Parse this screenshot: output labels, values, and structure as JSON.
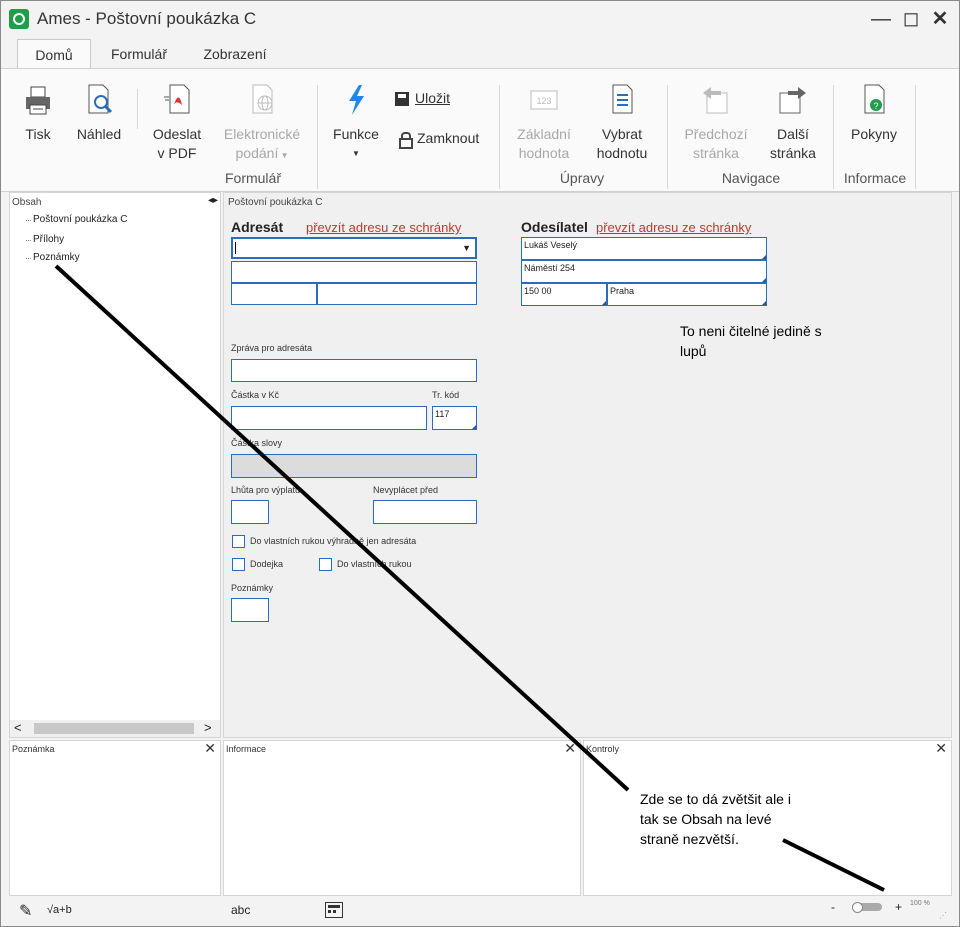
{
  "window": {
    "title": "Ames - Poštovní poukázka C"
  },
  "tabs": [
    {
      "label": "Domů"
    },
    {
      "label": "Formulář"
    },
    {
      "label": "Zobrazení"
    }
  ],
  "ribbon": {
    "print": "Tisk",
    "preview": "Náhled",
    "send_pdf_1": "Odeslat",
    "send_pdf_2": "v PDF",
    "efile_1": "Elektronické",
    "efile_2": "podání",
    "functions": "Funkce",
    "save": "Uložit",
    "lock": "Zamknout",
    "base_value_1": "Základní",
    "base_value_2": "hodnota",
    "pick_value_1": "Vybrat",
    "pick_value_2": "hodnotu",
    "prev_page_1": "Předchozí",
    "prev_page_2": "stránka",
    "next_page_1": "Další",
    "next_page_2": "stránka",
    "instructions": "Pokyny",
    "groups": {
      "form": "Formulář",
      "edits": "Úpravy",
      "navigation": "Navigace",
      "info": "Informace"
    }
  },
  "left_pane": {
    "title": "Obsah",
    "items": [
      "Poštovní poukázka C",
      "Přílohy",
      "Poznámky"
    ]
  },
  "form": {
    "pane_title": "Poštovní poukázka C",
    "recipient": {
      "header": "Adresát",
      "link": "převzít adresu ze schránky"
    },
    "sender": {
      "header": "Odesílatel",
      "link": "převzít adresu ze schránky",
      "name": "Lukáš Veselý",
      "street": "Náměstí 254",
      "zip": "150 00",
      "city": "Praha"
    },
    "message_label": "Zpráva pro adresáta",
    "amount_label": "Částka v Kč",
    "tr_code_label": "Tr. kód",
    "tr_code_value": "117",
    "amount_words_label": "Částka slovy",
    "payout_deadline_label": "Lhůta pro výplatu",
    "no_pay_before_label": "Nevyplácet před",
    "own_hands_only_label": "Do vlastních rukou výhradně jen adresáta",
    "delivery_receipt_label": "Dodejka",
    "own_hands_label": "Do vlastních rukou",
    "notes_label": "Poznámky"
  },
  "bottom": {
    "note_title": "Poznámka",
    "info_title": "Informace",
    "checks_title": "Kontroly"
  },
  "status": {
    "abc": "abc",
    "sqrt": "√a+b",
    "zoom_minus": "-",
    "zoom_plus": "+",
    "zoom_value": "100 %"
  },
  "annotations": {
    "a1_line1": "To neni čitelné jedině s",
    "a1_line2": "lupů",
    "a2_line1": "Zde se to dá zvětšit ale i",
    "a2_line2": "tak se Obsah na levé",
    "a2_line3": "straně nezvětší."
  }
}
